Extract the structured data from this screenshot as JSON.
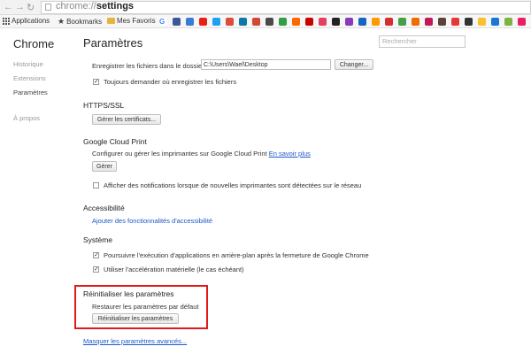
{
  "browser": {
    "url_scheme": "chrome://",
    "url_host": "settings",
    "back_icon": "arrow-left",
    "forward_icon": "arrow-right",
    "reload_icon": "reload"
  },
  "bookmarks": {
    "apps_label": "Applications",
    "bookmarks_label": "Bookmarks",
    "favoris_label": "Mes Favoris"
  },
  "sidebar": {
    "brand": "Chrome",
    "items": [
      {
        "label": "Historique"
      },
      {
        "label": "Extensions"
      },
      {
        "label": "Paramètres"
      },
      {
        "label": "À propos"
      }
    ]
  },
  "header": {
    "title": "Paramètres",
    "search_placeholder": "Rechercher"
  },
  "downloads": {
    "folder_label": "Enregistrer les fichiers dans le dossier :",
    "folder_value": "C:\\Users\\Wael\\Desktop",
    "change_button": "Changer...",
    "ask_label": "Toujours demander où enregistrer les fichiers",
    "ask_checked": true
  },
  "https": {
    "title": "HTTPS/SSL",
    "certs_button": "Gérer les certificats..."
  },
  "cloud_print": {
    "title": "Google Cloud Print",
    "desc": "Configurer ou gérer les imprimantes sur Google Cloud Print",
    "learn_more": "En savoir plus",
    "manage_button": "Gérer",
    "notify_label": "Afficher des notifications lorsque de nouvelles imprimantes sont détectées sur le réseau",
    "notify_checked": false
  },
  "accessibility": {
    "title": "Accessibilité",
    "add_link": "Ajouter des fonctionnalités d'accessibilité"
  },
  "system": {
    "title": "Système",
    "background_label": "Poursuivre l'exécution d'applications en arrière-plan après la fermeture de Google Chrome",
    "background_checked": true,
    "hw_accel_label": "Utiliser l'accélération matérielle (le cas échéant)",
    "hw_accel_checked": true
  },
  "reset": {
    "title": "Réinitialiser les paramètres",
    "desc": "Restaurer les paramètres par défaut",
    "button": "Réinitialiser les paramètres",
    "highlight_color": "#e01b1b"
  },
  "footer": {
    "hide_advanced": "Masquer les paramètres avancés..."
  },
  "colors": {
    "link": "#1a59c8",
    "highlight": "#e01b1b"
  }
}
